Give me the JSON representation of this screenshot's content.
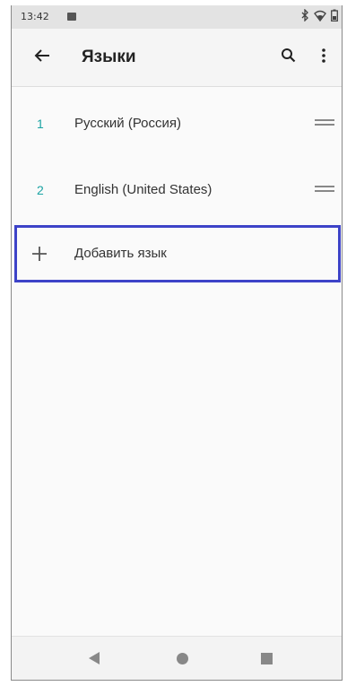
{
  "status_bar": {
    "time": "13:42",
    "icons": [
      "image-notification-icon",
      "bluetooth-icon",
      "wifi-icon",
      "battery-icon"
    ]
  },
  "app_bar": {
    "title": "Языки",
    "back_icon": "arrow-left-icon",
    "search_icon": "search-icon",
    "more_icon": "more-vert-icon"
  },
  "languages": [
    {
      "index": "1",
      "name": "Русский (Россия)"
    },
    {
      "index": "2",
      "name": "English (United States)"
    }
  ],
  "add_language": {
    "label": "Добавить язык",
    "icon": "plus-icon"
  },
  "nav_bar": {
    "icons": [
      "nav-back-icon",
      "nav-home-icon",
      "nav-recents-icon"
    ]
  },
  "colors": {
    "accent_index": "#1aa3a3",
    "focus_outline": "#3d43c8"
  }
}
